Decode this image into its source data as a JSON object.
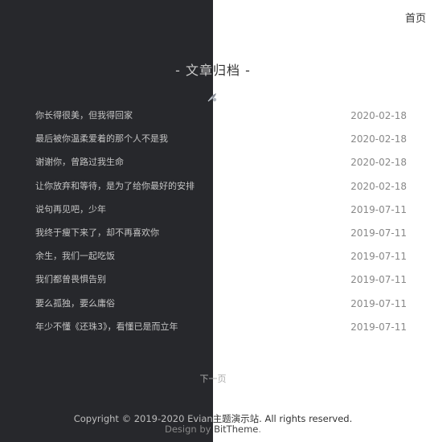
{
  "nav": {
    "home_label": "首页"
  },
  "archive": {
    "title_left": "- 文章",
    "title_right": "归档 -",
    "posts": [
      {
        "title": "你长得很美，但我得回家",
        "date": "2020-02-18"
      },
      {
        "title": "最后被你温柔爱着的那个人不是我",
        "date": "2020-02-18"
      },
      {
        "title": "谢谢你，曾路过我生命",
        "date": "2020-02-18"
      },
      {
        "title": "让你放弃和等待，是为了给你最好的安排",
        "date": "2020-02-18"
      },
      {
        "title": "说句再见吧，少年",
        "date": "2019-07-11"
      },
      {
        "title": "我终于瘦下来了，却不再喜欢你",
        "date": "2019-07-11"
      },
      {
        "title": "余生，我们一起吃饭",
        "date": "2019-07-11"
      },
      {
        "title": "我们都曾畏惧告别",
        "date": "2019-07-11"
      },
      {
        "title": "要么孤独，要么庸俗",
        "date": "2019-07-11"
      },
      {
        "title": "年少不懂《还珠3》，看懂已是而立年",
        "date": "2019-07-11"
      }
    ]
  },
  "pager": {
    "next_label": "下一页"
  },
  "footer": {
    "copyright_left": "Copyright © 2019-2020 Evian",
    "copyright_right": "主题演示站. All rights reserved.",
    "design_prefix": "Design by ",
    "design_link": "BitTheme",
    "design_suffix": "."
  },
  "colors": {
    "dark_panel": "#27282c",
    "background": "#ffffff"
  },
  "icons": {
    "title_icon": "feather-pen-icon"
  }
}
